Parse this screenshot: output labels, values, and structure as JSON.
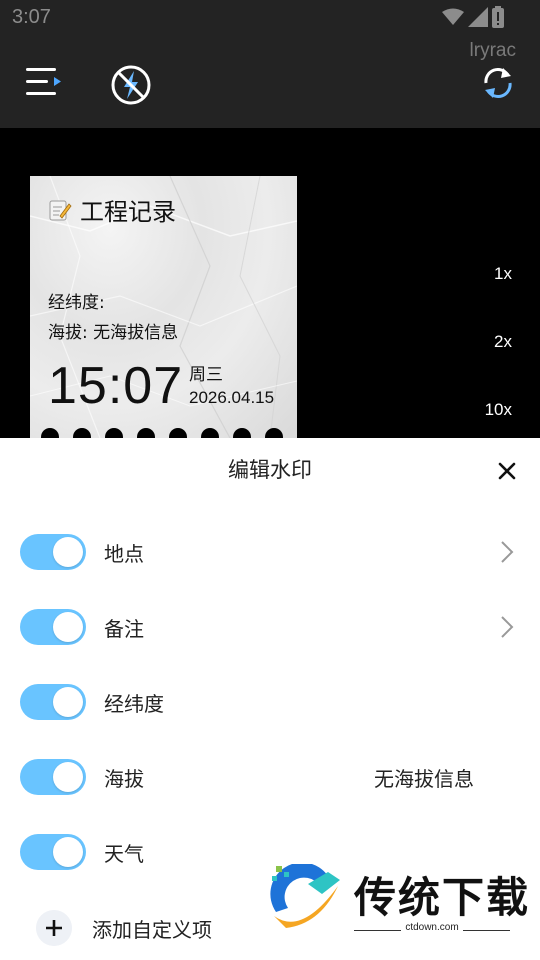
{
  "status_bar": {
    "time": "3:07",
    "icons": [
      "wifi-icon",
      "signal-icon",
      "battery-icon"
    ]
  },
  "toolbar": {
    "username": "lryrac",
    "icons": [
      "menu-icon",
      "flash-off-icon",
      "switch-camera-icon"
    ]
  },
  "watermark": {
    "title": "工程记录",
    "coords_label": "经纬度:",
    "altitude_line": "海拔: 无海拔信息",
    "time": "15:07",
    "weekday": "周三",
    "date": "2026.04.15"
  },
  "zoom": [
    "1x",
    "2x",
    "10x"
  ],
  "sheet": {
    "title": "编辑水印",
    "rows": [
      {
        "label": "地点",
        "enabled": true,
        "value": "",
        "has_arrow": true
      },
      {
        "label": "备注",
        "enabled": true,
        "value": "",
        "has_arrow": true
      },
      {
        "label": "经纬度",
        "enabled": true,
        "value": "",
        "has_arrow": false
      },
      {
        "label": "海拔",
        "enabled": true,
        "value": "无海拔信息",
        "has_arrow": false
      },
      {
        "label": "天气",
        "enabled": true,
        "value": "",
        "has_arrow": false
      }
    ],
    "add_label": "添加自定义项"
  },
  "brand": {
    "name": "传统下载",
    "url": "ctdown.com"
  },
  "colors": {
    "toggle_on": "#69c4ff",
    "toolbar_bg": "#232323",
    "brand_blue": "#1e73d8",
    "brand_orange": "#f5a623"
  }
}
